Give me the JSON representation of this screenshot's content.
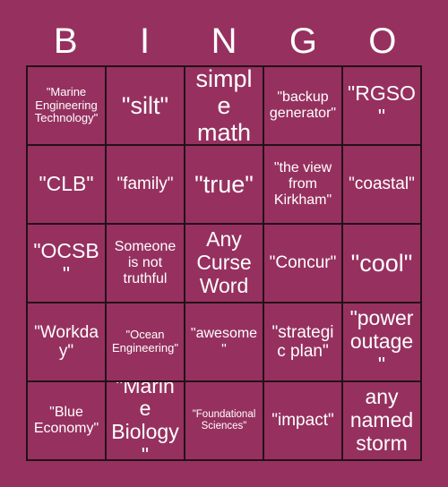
{
  "header": {
    "letters": [
      "B",
      "I",
      "N",
      "G",
      "O"
    ]
  },
  "grid": {
    "rows": 5,
    "columns": 5,
    "border_color": "#231019",
    "background_color": "#96315f",
    "text_color": "#ffffff",
    "cells": [
      {
        "label": "\"Marine Engineering Technology\"",
        "size": "xs"
      },
      {
        "label": "\"silt\"",
        "size": "xl"
      },
      {
        "label": "simple math",
        "size": "xl"
      },
      {
        "label": "\"backup generator\"",
        "size": "sm"
      },
      {
        "label": "\"RGSO\"",
        "size": "lg"
      },
      {
        "label": "\"CLB\"",
        "size": "lg"
      },
      {
        "label": "\"family\"",
        "size": "md"
      },
      {
        "label": "\"true\"",
        "size": "xl"
      },
      {
        "label": "\"the view from Kirkham\"",
        "size": "sm"
      },
      {
        "label": "\"coastal\"",
        "size": "md"
      },
      {
        "label": "\"OCSB\"",
        "size": "lg"
      },
      {
        "label": "Someone is not truthful",
        "size": "sm"
      },
      {
        "label": "Any Curse Word",
        "size": "lg"
      },
      {
        "label": "\"Concur\"",
        "size": "md"
      },
      {
        "label": "\"cool\"",
        "size": "xl"
      },
      {
        "label": "\"Workday\"",
        "size": "md"
      },
      {
        "label": "\"Ocean Engineering\"",
        "size": "xs"
      },
      {
        "label": "\"awesome\"",
        "size": "sm"
      },
      {
        "label": "\"strategic plan\"",
        "size": "md"
      },
      {
        "label": "\"power outage\"",
        "size": "lg"
      },
      {
        "label": "\"Blue Economy\"",
        "size": "sm"
      },
      {
        "label": "\"Marine Biology\"",
        "size": "lg"
      },
      {
        "label": "\"Foundational Sciences\"",
        "size": "xxs"
      },
      {
        "label": "\"impact\"",
        "size": "md"
      },
      {
        "label": "any named storm",
        "size": "lg"
      }
    ]
  }
}
